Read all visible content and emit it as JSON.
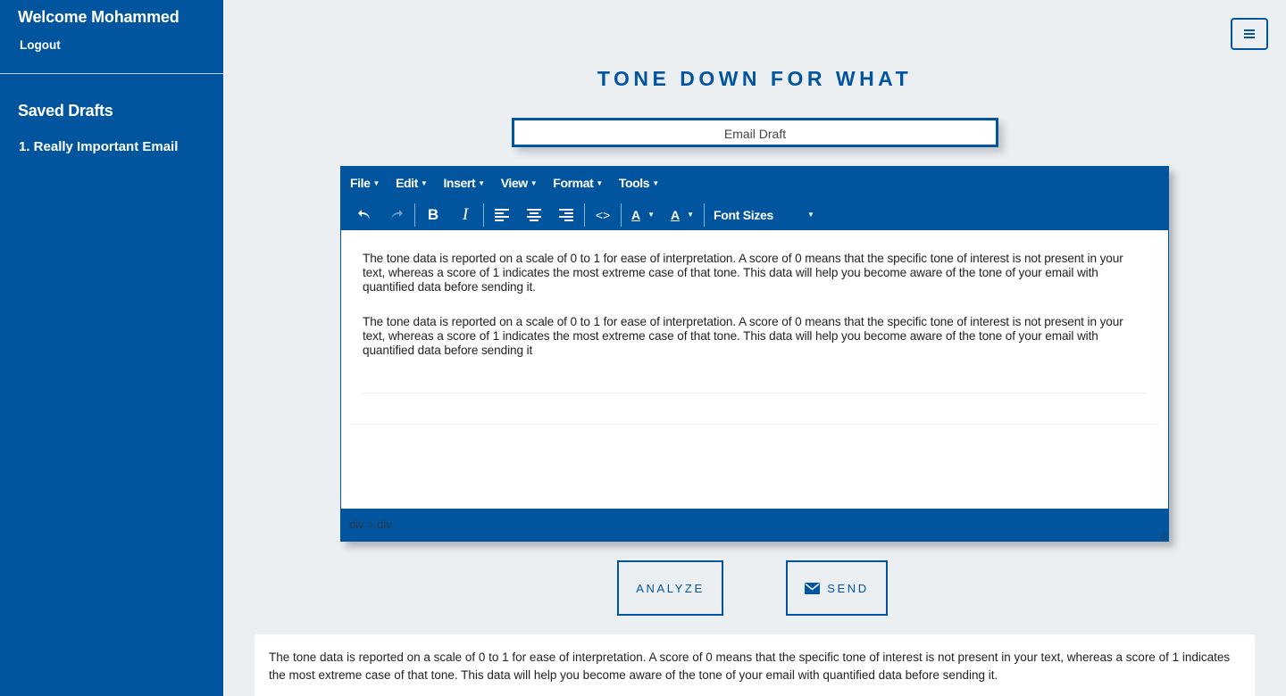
{
  "sidebar": {
    "welcome": "Welcome Mohammed",
    "logout": "Logout",
    "drafts_title": "Saved Drafts",
    "drafts": [
      "1. Really Important Email"
    ]
  },
  "header": {
    "menu_icon": "hamburger-menu-icon",
    "title": "TONE DOWN FOR WHAT"
  },
  "subject": {
    "value": "Email Draft"
  },
  "editor": {
    "menu": [
      "File",
      "Edit",
      "Insert",
      "View",
      "Format",
      "Tools"
    ],
    "toolbar": {
      "text_color_label": "A",
      "bg_color_label": "A",
      "font_sizes_label": "Font Sizes"
    },
    "paragraphs": [
      "The tone data is reported on a scale of 0 to 1 for ease of interpretation. A score of 0 means that the specific tone of interest is not present in your text, whereas a score of 1 indicates the most extreme case of that tone. This data will help you become aware of the tone of your email with quantified data before sending it.",
      "The tone data is reported on a scale of 0 to 1 for ease of interpretation. A score of 0 means that the specific tone of interest is not present in your text, whereas a score of 1 indicates the most extreme case of that tone. This data will help you become aware of the tone of your email with quantified data before sending it"
    ],
    "status_path": "div » div"
  },
  "actions": {
    "analyze_label": "ANALYZE",
    "send_label": "SEND",
    "send_icon": "envelope-icon"
  },
  "result": {
    "text": "The tone data is reported on a scale of 0 to 1 for ease of interpretation. A score of 0 means that the specific tone of interest is not present in your text, whereas a score of 1 indicates the most extreme case of that tone. This data will help you become aware of the tone of your email with quantified data before sending it."
  },
  "colors": {
    "primary": "#01559e",
    "background": "#eceff2"
  }
}
